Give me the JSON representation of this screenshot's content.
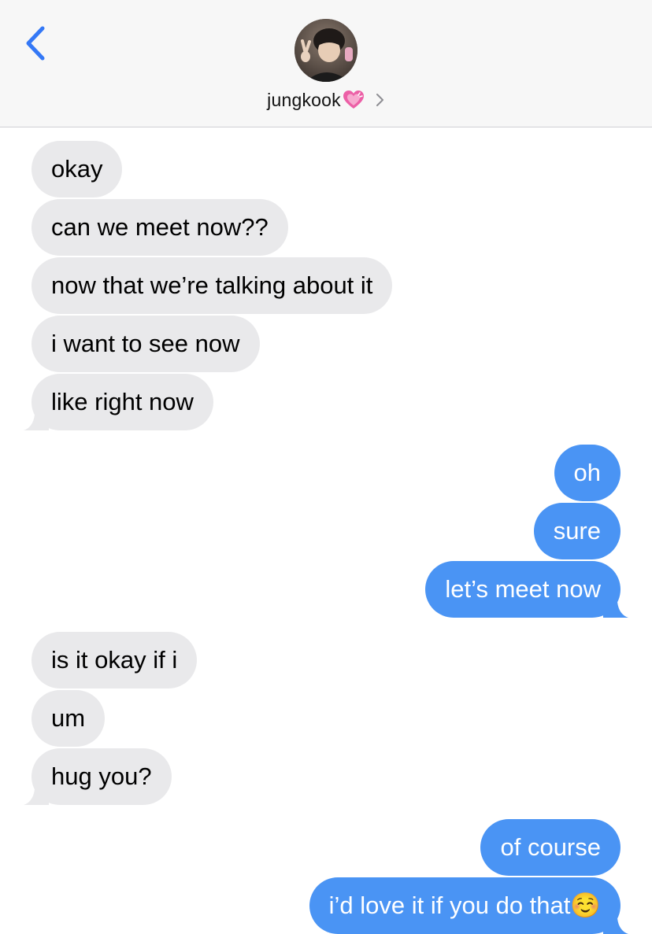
{
  "header": {
    "contact_name": "jungkook",
    "contact_emoji": "heart-icon"
  },
  "colors": {
    "received_bubble": "#e9e9eb",
    "sent_bubble": "#4a94f4",
    "accent_blue": "#3478f6",
    "heart_pink": "#ec5fa6"
  },
  "messages": [
    {
      "from": "them",
      "text": "okay"
    },
    {
      "from": "them",
      "text": "can we meet now??"
    },
    {
      "from": "them",
      "text": "now that we’re talking about it"
    },
    {
      "from": "them",
      "text": "i want to see now"
    },
    {
      "from": "them",
      "text": "like right now"
    },
    {
      "from": "me",
      "text": "oh"
    },
    {
      "from": "me",
      "text": "sure"
    },
    {
      "from": "me",
      "text": "let’s meet now"
    },
    {
      "from": "them",
      "text": "is it okay if i"
    },
    {
      "from": "them",
      "text": "um"
    },
    {
      "from": "them",
      "text": "hug you?"
    },
    {
      "from": "me",
      "text": "of course"
    },
    {
      "from": "me",
      "text": "i’d love it if you do that☺️"
    }
  ]
}
